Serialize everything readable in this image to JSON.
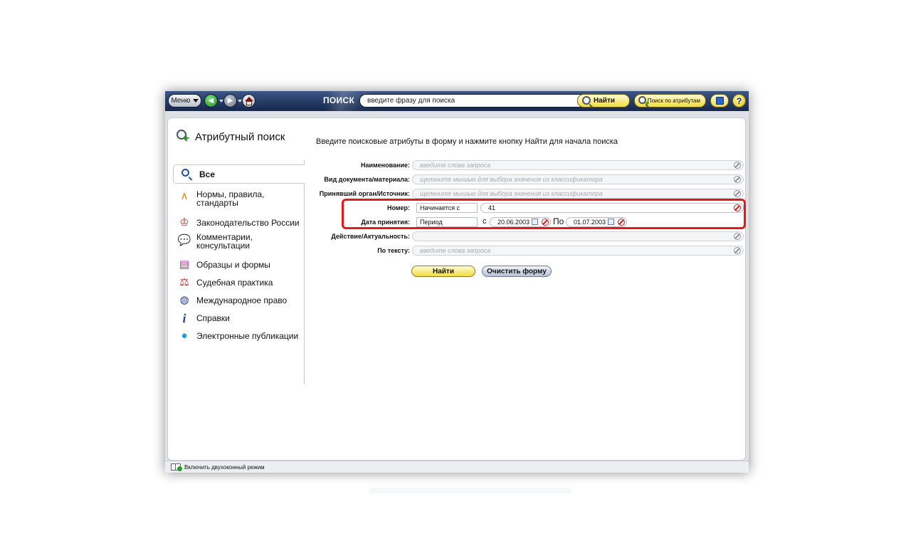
{
  "toolbar": {
    "menu_label": "Меню",
    "search_section_label": "ПОИСК",
    "search_placeholder": "введите фразу для поиска",
    "find_button": "Найти",
    "attribute_search_button": "Поиск по атрибутам",
    "help_label": "?"
  },
  "sidebar": {
    "title": "Атрибутный поиск",
    "items": [
      {
        "label": "Все",
        "icon": "search-icon",
        "selected": true
      },
      {
        "label": "Нормы, правила, стандарты",
        "icon": "compass-icon"
      },
      {
        "label": "Законодательство России",
        "icon": "eagle-emblem-icon"
      },
      {
        "label": "Комментарии, консультации",
        "icon": "speech-bubble-icon"
      },
      {
        "label": "Образцы и формы",
        "icon": "form-document-icon"
      },
      {
        "label": "Судебная практика",
        "icon": "scales-icon"
      },
      {
        "label": "Международное право",
        "icon": "globe-icon"
      },
      {
        "label": "Справки",
        "icon": "info-icon"
      },
      {
        "label": "Электронные публикации",
        "icon": "disc-icon"
      }
    ]
  },
  "form": {
    "instruction": "Введите поисковые атрибуты в форму и нажмите кнопку Найти для начала поиска",
    "fields": {
      "name": {
        "label": "Наименование:",
        "placeholder": "введите слова запроса"
      },
      "doc_type": {
        "label": "Вид документа/материала:",
        "placeholder": "щелкните мышью для выбора значения из классификатора"
      },
      "issuer": {
        "label": "Принявший орган/Источник:",
        "placeholder": "щелкните мышью для выбора значения из классификатора"
      },
      "number": {
        "label": "Номер:",
        "mode": "Начинается с",
        "value": "41"
      },
      "adoption_date": {
        "label": "Дата принятия:",
        "mode": "Период",
        "from_label": "с",
        "from": "20.06.2003",
        "to_label": "По",
        "to": "01.07.2003"
      },
      "status": {
        "label": "Действие/Актуальность:",
        "placeholder": ""
      },
      "text": {
        "label": "По тексту:",
        "placeholder": "введите слова запроса"
      }
    },
    "find_button": "Найти",
    "clear_button": "Очистить форму"
  },
  "statusbar": {
    "dual_window_label": "Включить двухоконный режим"
  },
  "colors": {
    "toolbar_top": "#3b5687",
    "toolbar_bottom": "#16274c",
    "accent_yellow": "#f1dc3f",
    "highlight_red": "#e11a1a"
  }
}
